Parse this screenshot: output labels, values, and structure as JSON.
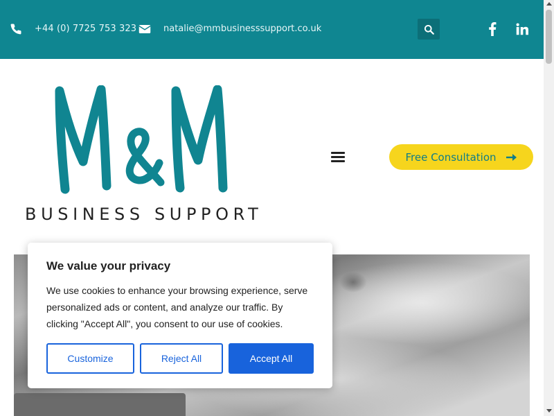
{
  "topbar": {
    "phone": "+44 (0) 7725 753 323",
    "email": "natalie@mmbusinesssupport.co.uk",
    "icons": [
      "phone-icon",
      "envelope-icon",
      "search-icon",
      "facebook-icon",
      "linkedin-icon"
    ],
    "background_color": "#0f8691"
  },
  "header": {
    "logo_letters": "M&M",
    "logo_tagline": "BUSINESS SUPPORT",
    "menu_icon": "hamburger-menu-icon",
    "cta_label": "Free Consultation",
    "cta_color": "#f6d51d",
    "brand_color": "#0f8691"
  },
  "cookie_banner": {
    "title": "We value your privacy",
    "body": "We use cookies to enhance your browsing experience, serve personalized ads or content, and analyze our traffic. By clicking \"Accept All\", you consent to our use of cookies.",
    "customize_label": "Customize",
    "reject_label": "Reject All",
    "accept_label": "Accept All",
    "accent_color": "#1863dc"
  }
}
